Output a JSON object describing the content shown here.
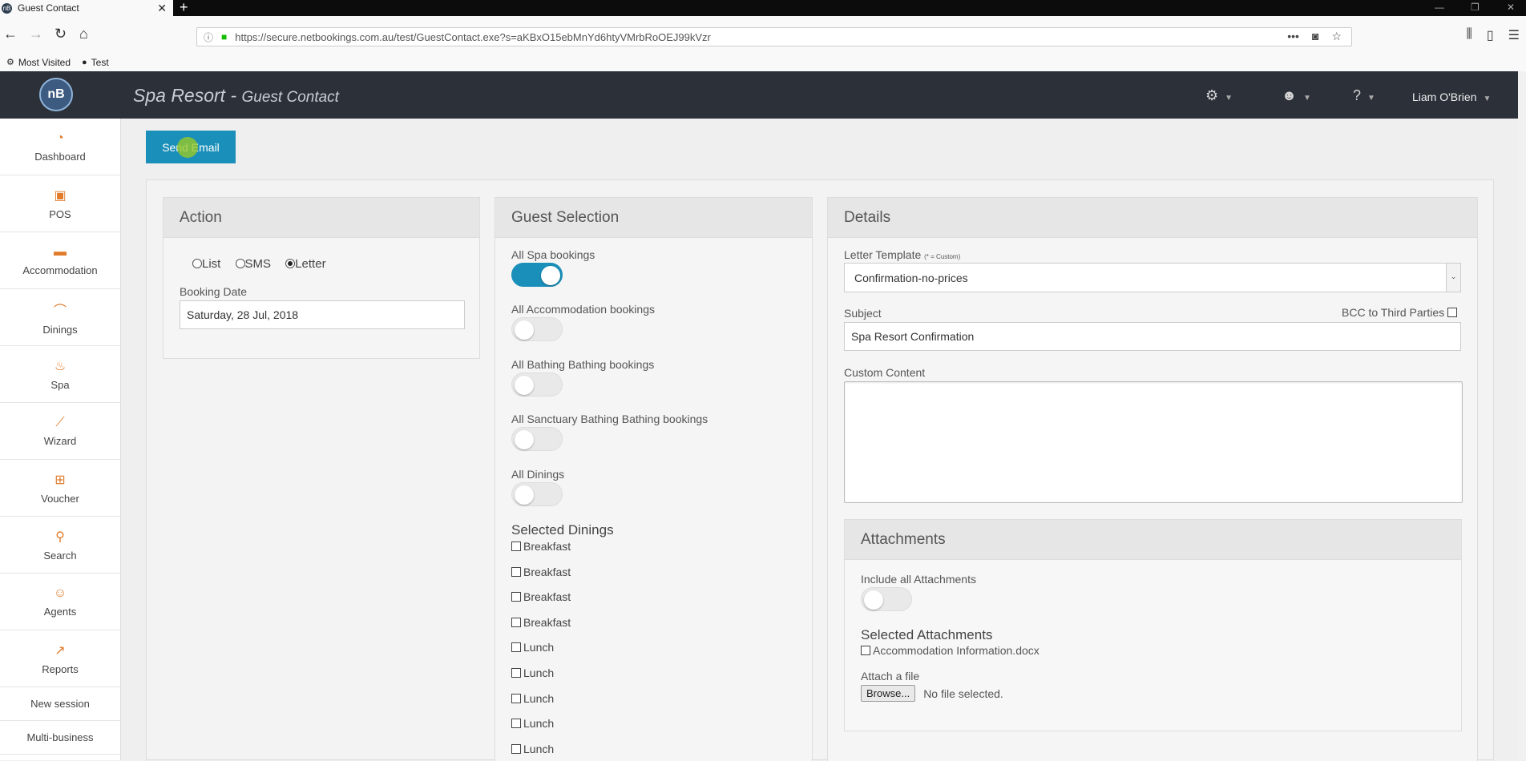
{
  "browser": {
    "tab_title": "Guest Contact",
    "tab_favicon": "nB",
    "url": "https://secure.netbookings.com.au/test/GuestContact.exe?s=aKBxO15ebMnYd6htyVMrbRoOEJ99kVzr",
    "bookmarks": [
      "Most Visited",
      "Test"
    ]
  },
  "header": {
    "logo": "nB",
    "app_title": "Spa Resort",
    "separator": " - ",
    "page_title": "Guest Contact",
    "user_name": "Liam O'Brien"
  },
  "sidebar": {
    "items": [
      {
        "label": "Dashboard",
        "icon": "gauge-icon",
        "glyph": "◔"
      },
      {
        "label": "POS",
        "icon": "pos-icon",
        "glyph": "▣"
      },
      {
        "label": "Accommodation",
        "icon": "bed-icon",
        "glyph": "▬"
      },
      {
        "label": "Dinings",
        "icon": "dining-icon",
        "glyph": "⌒"
      },
      {
        "label": "Spa",
        "icon": "spa-icon",
        "glyph": "♨"
      },
      {
        "label": "Wizard",
        "icon": "wand-icon",
        "glyph": "⟋"
      },
      {
        "label": "Voucher",
        "icon": "gift-icon",
        "glyph": "⊞"
      },
      {
        "label": "Search",
        "icon": "search-icon",
        "glyph": "⚲"
      },
      {
        "label": "Agents",
        "icon": "agent-icon",
        "glyph": "☺"
      },
      {
        "label": "Reports",
        "icon": "chart-icon",
        "glyph": "↗"
      }
    ],
    "new_session": "New session",
    "multi_business": "Multi-business"
  },
  "send_email_label": "Send Email",
  "action": {
    "title": "Action",
    "options": [
      "List",
      "SMS",
      "Letter"
    ],
    "selected": "Letter",
    "booking_date_label": "Booking Date",
    "booking_date_value": "Saturday, 28 Jul, 2018"
  },
  "guest_selection": {
    "title": "Guest Selection",
    "toggles": [
      {
        "label": "All Spa bookings",
        "on": true
      },
      {
        "label": "All Accommodation bookings",
        "on": false
      },
      {
        "label": "All Bathing Bathing bookings",
        "on": false
      },
      {
        "label": "All Sanctuary Bathing Bathing bookings",
        "on": false
      },
      {
        "label": "All Dinings",
        "on": false
      }
    ],
    "selected_dinings_title": "Selected Dinings",
    "dinings": [
      "Breakfast",
      "Breakfast",
      "Breakfast",
      "Breakfast",
      "Lunch",
      "Lunch",
      "Lunch",
      "Lunch",
      "Lunch"
    ]
  },
  "details": {
    "title": "Details",
    "letter_template_label": "Letter Template",
    "letter_template_note": "(* = Custom)",
    "letter_template_value": "Confirmation-no-prices",
    "subject_label": "Subject",
    "bcc_label": "BCC to Third Parties",
    "subject_value": "Spa Resort Confirmation",
    "custom_content_label": "Custom Content",
    "custom_content_value": ""
  },
  "attachments": {
    "title": "Attachments",
    "include_all_label": "Include all Attachments",
    "include_all_on": false,
    "selected_title": "Selected Attachments",
    "files": [
      "Accommodation Information.docx"
    ],
    "attach_label": "Attach a file",
    "browse_label": "Browse...",
    "no_file_label": "No file selected."
  },
  "colors": {
    "primary": "#1a8fb9",
    "header_bg": "#2b3039",
    "sidebar_icon": "#e07b2c"
  }
}
